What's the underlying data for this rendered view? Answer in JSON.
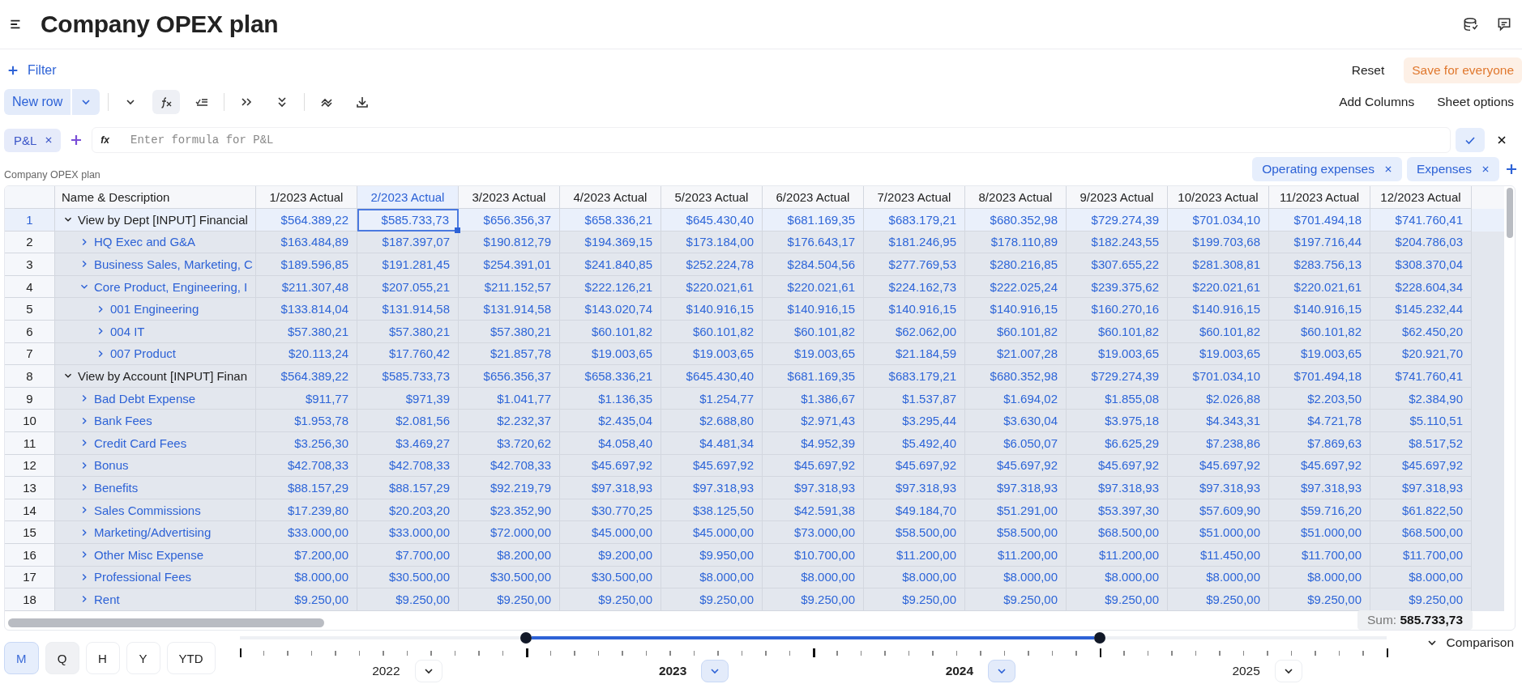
{
  "header": {
    "title": "Company OPEX plan"
  },
  "filter_bar": {
    "filter_label": "Filter",
    "buttons": [
      {
        "label": "Reset",
        "kind": "plain"
      },
      {
        "label": "Save for everyone",
        "kind": "accent"
      }
    ]
  },
  "toolbar": {
    "new_row": "New row",
    "tools": [
      {
        "kind": "chevron",
        "active": false
      },
      {
        "kind": "formula",
        "active": true
      },
      {
        "kind": "lines",
        "active": false
      },
      {
        "kind": "double-right",
        "active": false
      },
      {
        "kind": "double-down",
        "active": false
      },
      {
        "kind": "squiggle",
        "active": false
      },
      {
        "kind": "download",
        "active": false
      }
    ],
    "right_buttons": [
      "Add Columns",
      "Sheet options"
    ]
  },
  "formula_bar": {
    "chips": [
      {
        "label": "P&L"
      }
    ],
    "fx": "fx",
    "placeholder": "Enter formula for P&L"
  },
  "sheet_label": "Company OPEX plan",
  "tags": [
    {
      "label": "Operating expenses"
    },
    {
      "label": "Expenses"
    }
  ],
  "table": {
    "columns": [
      {
        "label": "Name & Description",
        "selected": false
      },
      {
        "label": "1/2023 Actual",
        "selected": false
      },
      {
        "label": "2/2023 Actual",
        "selected": true
      },
      {
        "label": "3/2023 Actual",
        "selected": false
      },
      {
        "label": "4/2023 Actual",
        "selected": false
      },
      {
        "label": "5/2023 Actual",
        "selected": false
      },
      {
        "label": "6/2023 Actual",
        "selected": false
      },
      {
        "label": "7/2023 Actual",
        "selected": false
      },
      {
        "label": "8/2023 Actual",
        "selected": false
      },
      {
        "label": "9/2023 Actual",
        "selected": false
      },
      {
        "label": "10/2023 Actual",
        "selected": false
      },
      {
        "label": "11/2023 Actual",
        "selected": false
      },
      {
        "label": "12/2023 Actual",
        "selected": false
      }
    ],
    "rows": [
      {
        "num": "1",
        "name": "View by Dept [INPUT] Financial",
        "expanded": true,
        "selected": true,
        "values": [
          "$564.389,22",
          "$585.733,73",
          "$656.356,37",
          "$658.336,21",
          "$645.430,40",
          "$681.169,35",
          "$683.179,21",
          "$680.352,98",
          "$729.274,39",
          "$701.034,10",
          "$701.494,18",
          "$741.760,41"
        ],
        "children": [
          {
            "num": "2",
            "name": "HQ Exec and G&A",
            "expanded": false,
            "selected": false,
            "values": [
              "$163.484,89",
              "$187.397,07",
              "$190.812,79",
              "$194.369,15",
              "$173.184,00",
              "$176.643,17",
              "$181.246,95",
              "$178.110,89",
              "$182.243,55",
              "$199.703,68",
              "$197.716,44",
              "$204.786,03"
            ]
          },
          {
            "num": "3",
            "name": "Business Sales, Marketing, C",
            "expanded": false,
            "selected": false,
            "values": [
              "$189.596,85",
              "$191.281,45",
              "$254.391,01",
              "$241.840,85",
              "$252.224,78",
              "$284.504,56",
              "$277.769,53",
              "$280.216,85",
              "$307.655,22",
              "$281.308,81",
              "$283.756,13",
              "$308.370,04"
            ]
          },
          {
            "num": "4",
            "name": "Core Product, Engineering, I",
            "expanded": true,
            "selected": false,
            "values": [
              "$211.307,48",
              "$207.055,21",
              "$211.152,57",
              "$222.126,21",
              "$220.021,61",
              "$220.021,61",
              "$224.162,73",
              "$222.025,24",
              "$239.375,62",
              "$220.021,61",
              "$220.021,61",
              "$228.604,34"
            ],
            "children": [
              {
                "num": "5",
                "name": "001 Engineering",
                "expanded": false,
                "selected": false,
                "values": [
                  "$133.814,04",
                  "$131.914,58",
                  "$131.914,58",
                  "$143.020,74",
                  "$140.916,15",
                  "$140.916,15",
                  "$140.916,15",
                  "$140.916,15",
                  "$160.270,16",
                  "$140.916,15",
                  "$140.916,15",
                  "$145.232,44"
                ]
              },
              {
                "num": "6",
                "name": "004 IT",
                "expanded": false,
                "selected": false,
                "values": [
                  "$57.380,21",
                  "$57.380,21",
                  "$57.380,21",
                  "$60.101,82",
                  "$60.101,82",
                  "$60.101,82",
                  "$62.062,00",
                  "$60.101,82",
                  "$60.101,82",
                  "$60.101,82",
                  "$60.101,82",
                  "$62.450,20"
                ]
              },
              {
                "num": "7",
                "name": "007 Product",
                "expanded": false,
                "selected": false,
                "values": [
                  "$20.113,24",
                  "$17.760,42",
                  "$21.857,78",
                  "$19.003,65",
                  "$19.003,65",
                  "$19.003,65",
                  "$21.184,59",
                  "$21.007,28",
                  "$19.003,65",
                  "$19.003,65",
                  "$19.003,65",
                  "$20.921,70"
                ]
              }
            ]
          }
        ]
      },
      {
        "num": "8",
        "name": "View by Account [INPUT] Finan",
        "expanded": true,
        "selected": false,
        "values": [
          "$564.389,22",
          "$585.733,73",
          "$656.356,37",
          "$658.336,21",
          "$645.430,40",
          "$681.169,35",
          "$683.179,21",
          "$680.352,98",
          "$729.274,39",
          "$701.034,10",
          "$701.494,18",
          "$741.760,41"
        ],
        "children": [
          {
            "num": "9",
            "name": "Bad Debt Expense",
            "expanded": false,
            "selected": false,
            "values": [
              "$911,77",
              "$971,39",
              "$1.041,77",
              "$1.136,35",
              "$1.254,77",
              "$1.386,67",
              "$1.537,87",
              "$1.694,02",
              "$1.855,08",
              "$2.026,88",
              "$2.203,50",
              "$2.384,90"
            ]
          },
          {
            "num": "10",
            "name": "Bank Fees",
            "expanded": false,
            "selected": false,
            "values": [
              "$1.953,78",
              "$2.081,56",
              "$2.232,37",
              "$2.435,04",
              "$2.688,80",
              "$2.971,43",
              "$3.295,44",
              "$3.630,04",
              "$3.975,18",
              "$4.343,31",
              "$4.721,78",
              "$5.110,51"
            ]
          },
          {
            "num": "11",
            "name": "Credit Card Fees",
            "expanded": false,
            "selected": false,
            "values": [
              "$3.256,30",
              "$3.469,27",
              "$3.720,62",
              "$4.058,40",
              "$4.481,34",
              "$4.952,39",
              "$5.492,40",
              "$6.050,07",
              "$6.625,29",
              "$7.238,86",
              "$7.869,63",
              "$8.517,52"
            ]
          },
          {
            "num": "12",
            "name": "Bonus",
            "expanded": false,
            "selected": false,
            "values": [
              "$42.708,33",
              "$42.708,33",
              "$42.708,33",
              "$45.697,92",
              "$45.697,92",
              "$45.697,92",
              "$45.697,92",
              "$45.697,92",
              "$45.697,92",
              "$45.697,92",
              "$45.697,92",
              "$45.697,92"
            ]
          },
          {
            "num": "13",
            "name": "Benefits",
            "expanded": false,
            "selected": false,
            "values": [
              "$88.157,29",
              "$88.157,29",
              "$92.219,79",
              "$97.318,93",
              "$97.318,93",
              "$97.318,93",
              "$97.318,93",
              "$97.318,93",
              "$97.318,93",
              "$97.318,93",
              "$97.318,93",
              "$97.318,93"
            ]
          },
          {
            "num": "14",
            "name": "Sales Commissions",
            "expanded": false,
            "selected": false,
            "values": [
              "$17.239,80",
              "$20.203,20",
              "$23.352,90",
              "$30.770,25",
              "$38.125,50",
              "$42.591,38",
              "$49.184,70",
              "$51.291,00",
              "$53.397,30",
              "$57.609,90",
              "$59.716,20",
              "$61.822,50"
            ]
          },
          {
            "num": "15",
            "name": "Marketing/Advertising",
            "expanded": false,
            "selected": false,
            "values": [
              "$33.000,00",
              "$33.000,00",
              "$72.000,00",
              "$45.000,00",
              "$45.000,00",
              "$73.000,00",
              "$58.500,00",
              "$58.500,00",
              "$68.500,00",
              "$51.000,00",
              "$51.000,00",
              "$68.500,00"
            ]
          },
          {
            "num": "16",
            "name": "Other Misc Expense",
            "expanded": false,
            "selected": false,
            "values": [
              "$7.200,00",
              "$7.700,00",
              "$8.200,00",
              "$9.200,00",
              "$9.950,00",
              "$10.700,00",
              "$11.200,00",
              "$11.200,00",
              "$11.200,00",
              "$11.450,00",
              "$11.700,00",
              "$11.700,00"
            ]
          },
          {
            "num": "17",
            "name": "Professional Fees",
            "expanded": false,
            "selected": false,
            "values": [
              "$8.000,00",
              "$30.500,00",
              "$30.500,00",
              "$30.500,00",
              "$8.000,00",
              "$8.000,00",
              "$8.000,00",
              "$8.000,00",
              "$8.000,00",
              "$8.000,00",
              "$8.000,00",
              "$8.000,00"
            ]
          },
          {
            "num": "18",
            "name": "Rent",
            "expanded": false,
            "selected": false,
            "values": [
              "$9.250,00",
              "$9.250,00",
              "$9.250,00",
              "$9.250,00",
              "$9.250,00",
              "$9.250,00",
              "$9.250,00",
              "$9.250,00",
              "$9.250,00",
              "$9.250,00",
              "$9.250,00",
              "$9.250,00"
            ]
          }
        ]
      }
    ]
  },
  "sum_tooltip": {
    "label": "Sum:",
    "value": "585.733,73"
  },
  "timeline": {
    "granularity": [
      {
        "label": "M",
        "selected": true,
        "hovered": false
      },
      {
        "label": "Q",
        "selected": false,
        "hovered": true
      },
      {
        "label": "H",
        "selected": false,
        "hovered": false
      },
      {
        "label": "Y",
        "selected": false,
        "hovered": false
      },
      {
        "label": "YTD",
        "selected": false,
        "hovered": false
      }
    ],
    "years": [
      {
        "label": "2022",
        "selected": false
      },
      {
        "label": "2023",
        "selected": true
      },
      {
        "label": "2024",
        "selected": true
      },
      {
        "label": "2025",
        "selected": false
      }
    ],
    "comparison": "Comparison"
  }
}
